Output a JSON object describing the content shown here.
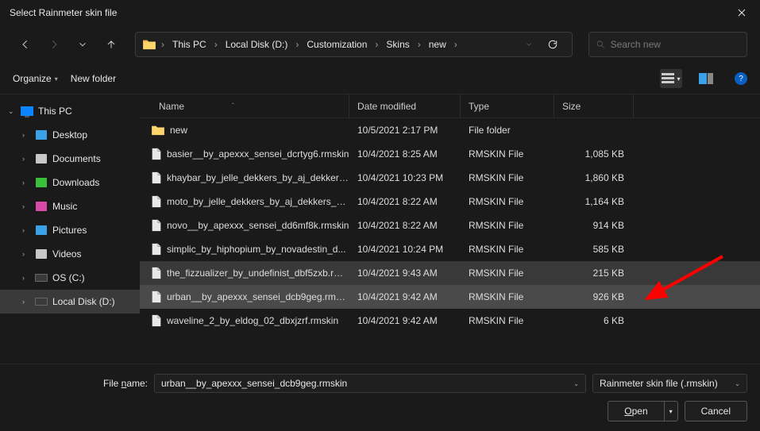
{
  "title": "Select Rainmeter skin file",
  "breadcrumbs": [
    "This PC",
    "Local Disk (D:)",
    "Customization",
    "Skins",
    "new"
  ],
  "search_placeholder": "Search new",
  "toolbar": {
    "organize": "Organize",
    "newfolder": "New folder"
  },
  "sidebar": [
    {
      "label": "This PC",
      "icon": "monitor",
      "expanded": true,
      "indent": false
    },
    {
      "label": "Desktop",
      "icon": "desktop",
      "indent": true,
      "color": "#3aa0e8"
    },
    {
      "label": "Documents",
      "icon": "documents",
      "indent": true,
      "color": "#c8c8c8"
    },
    {
      "label": "Downloads",
      "icon": "downloads",
      "indent": true,
      "color": "#3ac03a"
    },
    {
      "label": "Music",
      "icon": "music",
      "indent": true,
      "color": "#d84aa8"
    },
    {
      "label": "Pictures",
      "icon": "pictures",
      "indent": true,
      "color": "#3aa0e8"
    },
    {
      "label": "Videos",
      "icon": "videos",
      "indent": true,
      "color": "#c8c8c8"
    },
    {
      "label": "OS (C:)",
      "icon": "drive",
      "indent": true
    },
    {
      "label": "Local Disk (D:)",
      "icon": "drive",
      "indent": true,
      "selected": true
    }
  ],
  "columns": {
    "name": "Name",
    "date": "Date modified",
    "type": "Type",
    "size": "Size"
  },
  "files": [
    {
      "name": "new",
      "date": "10/5/2021 2:17 PM",
      "type": "File folder",
      "size": "",
      "folder": true
    },
    {
      "name": "basier__by_apexxx_sensei_dcrtyg6.rmskin",
      "date": "10/4/2021 8:25 AM",
      "type": "RMSKIN File",
      "size": "1,085 KB"
    },
    {
      "name": "khaybar_by_jelle_dekkers_by_aj_dekkers_...",
      "date": "10/4/2021 10:23 PM",
      "type": "RMSKIN File",
      "size": "1,860 KB"
    },
    {
      "name": "moto_by_jelle_dekkers_by_aj_dekkers_de...",
      "date": "10/4/2021 8:22 AM",
      "type": "RMSKIN File",
      "size": "1,164 KB"
    },
    {
      "name": "novo__by_apexxx_sensei_dd6mf8k.rmskin",
      "date": "10/4/2021 8:22 AM",
      "type": "RMSKIN File",
      "size": "914 KB"
    },
    {
      "name": "simplic_by_hiphopium_by_novadestin_d...",
      "date": "10/4/2021 10:24 PM",
      "type": "RMSKIN File",
      "size": "585 KB"
    },
    {
      "name": "the_fizzualizer_by_undefinist_dbf5zxb.rm...",
      "date": "10/4/2021 9:43 AM",
      "type": "RMSKIN File",
      "size": "215 KB",
      "highlighted": true
    },
    {
      "name": "urban__by_apexxx_sensei_dcb9geg.rmskin",
      "date": "10/4/2021 9:42 AM",
      "type": "RMSKIN File",
      "size": "926 KB",
      "selected": true
    },
    {
      "name": "waveline_2_by_eldog_02_dbxjzrf.rmskin",
      "date": "10/4/2021 9:42 AM",
      "type": "RMSKIN File",
      "size": "6 KB"
    }
  ],
  "filename_label": "File name:",
  "filename_value": "urban__by_apexxx_sensei_dcb9geg.rmskin",
  "filter": "Rainmeter skin file (.rmskin)",
  "buttons": {
    "open": "Open",
    "cancel": "Cancel"
  }
}
